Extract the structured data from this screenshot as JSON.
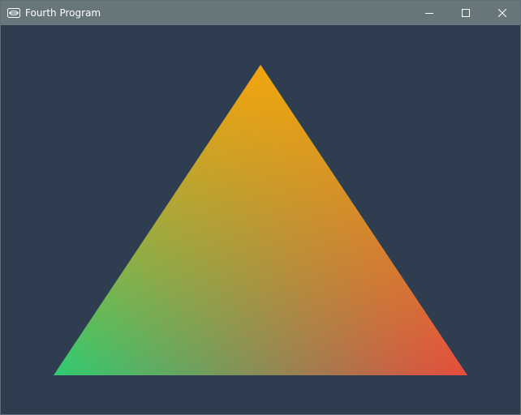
{
  "window": {
    "title": "Fourth Program",
    "app_icon": "opengl-eye-icon",
    "buttons": {
      "minimize": "minimize-icon",
      "maximize": "maximize-icon",
      "close": "close-icon"
    }
  },
  "colors": {
    "background": "#2e3d50",
    "titlebar": "#66767b",
    "vertex_top": "#f2a50e",
    "vertex_left": "#2ecc71",
    "vertex_right": "#e74c3c"
  }
}
